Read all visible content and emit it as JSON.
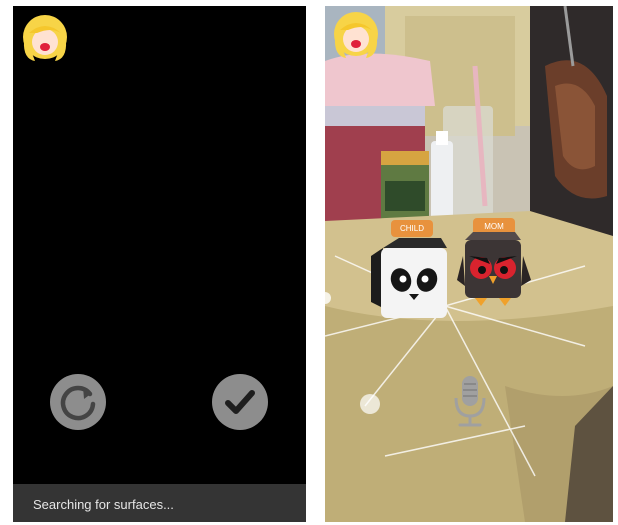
{
  "left_screen": {
    "status": "",
    "searching_message": "Searching for surfaces..."
  },
  "right_screen": {
    "status": "",
    "characters": [
      {
        "label": "CHILD",
        "icon": "panda-icon"
      },
      {
        "label": "MOM",
        "icon": "angry-owl-icon"
      }
    ],
    "mic_icon": "microphone-icon"
  },
  "colors": {
    "label_orange": "#e8923d",
    "button_gray": "#8d8d8d",
    "avatar_hair": "#f7d447",
    "lips": "#e0203a"
  }
}
